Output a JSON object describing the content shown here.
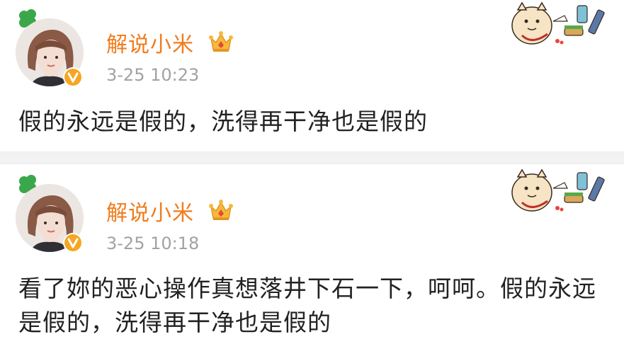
{
  "posts": [
    {
      "username": "解说小米",
      "timestamp": "3-25 10:23",
      "content": "假的永远是假的，洗得再干净也是假的",
      "badge_icon": "crown-icon",
      "verified_icon": "verified-v-icon"
    },
    {
      "username": "解说小米",
      "timestamp": "3-25 10:18",
      "content": "看了妳的恶心操作真想落井下石一下，呵呵。假的永远是假的，洗得再干净也是假的",
      "badge_icon": "crown-icon",
      "verified_icon": "verified-v-icon"
    }
  ],
  "colors": {
    "username": "#f07c1c",
    "timestamp": "#a2a2a2",
    "content": "#222222",
    "divider": "#f2f2f2",
    "verified": "#f5a623"
  }
}
